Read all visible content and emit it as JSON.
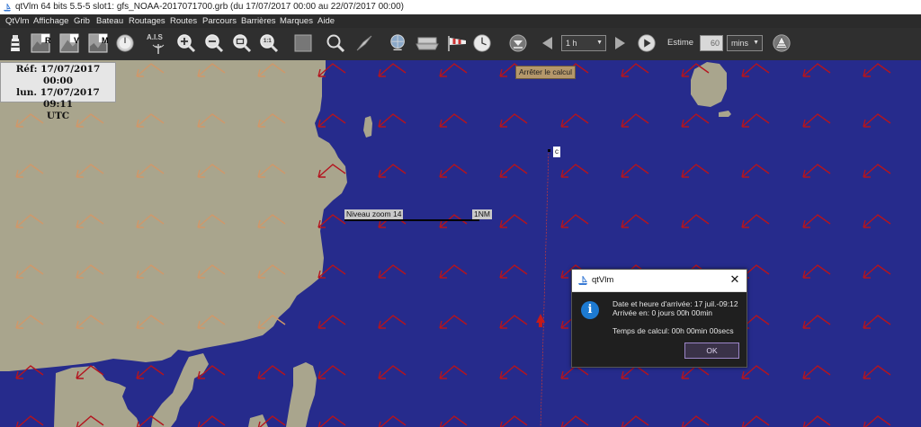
{
  "window": {
    "title": "qtVlm 64 bits 5.5-5 slot1: gfs_NOAA-2017071700.grb (du 17/07/2017 00:00 au 22/07/2017 00:00)"
  },
  "menu": {
    "items": [
      "QtVlm",
      "Affichage",
      "Grib",
      "Bateau",
      "Routages",
      "Routes",
      "Parcours",
      "Barrières",
      "Marques",
      "Aide"
    ]
  },
  "toolbar": {
    "r_label": "R",
    "v_label": "V",
    "m_label": "M",
    "ais_label": "A.I.S",
    "zoom_11_label": "1:1",
    "step_value": "1 h",
    "estime_label": "Estime",
    "estime_value": "60",
    "estime_unit": "mins"
  },
  "map": {
    "ref_line1": "Réf: 17/07/2017 00:00",
    "ref_line2": "lun. 17/07/2017 09:11",
    "ref_line3": "UTC",
    "stop_calc": "Arrêter le calcul",
    "marker_label": "c",
    "zoom_label": "Niveau zoom 14",
    "scale_label": "1NM"
  },
  "dialog": {
    "title": "qtVlm",
    "line1": "Date et heure d'arrivée: 17 juil.-09:12",
    "line2": "Arrivée en: 0 jours 00h 00min",
    "line3": "Temps de calcul: 00h 00min 00secs",
    "ok_label": "OK"
  },
  "colors": {
    "sea": "#262b8c",
    "land": "#a9a58d",
    "wind_sea": "#b4141e",
    "wind_land": "#d0986a",
    "dialog_bg": "#1f1f1f",
    "info_blue": "#1d7ad1"
  }
}
